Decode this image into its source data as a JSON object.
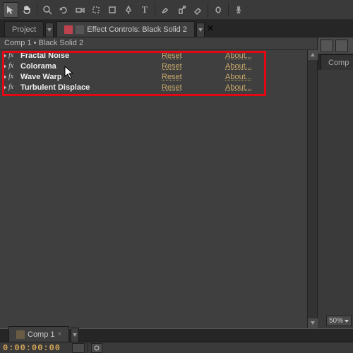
{
  "toolbar": {
    "tools": [
      "selection",
      "hand",
      "zoom",
      "rotate",
      "camera",
      "pan-behind",
      "mask-rect",
      "pen",
      "text",
      "brush",
      "clone",
      "eraser",
      "roto",
      "puppet"
    ]
  },
  "tabs": {
    "project": "Project",
    "effect_controls": "Effect Controls: Black Solid 2",
    "right_panel": "Comp"
  },
  "panel": {
    "breadcrumb": "Comp 1 • Black Solid 2"
  },
  "effects": [
    {
      "name": "Fractal Noise",
      "reset": "Reset",
      "about": "About..."
    },
    {
      "name": "Colorama",
      "reset": "Reset",
      "about": "About..."
    },
    {
      "name": "Wave Warp",
      "reset": "Reset",
      "about": "About..."
    },
    {
      "name": "Turbulent Displace",
      "reset": "Reset",
      "about": "About..."
    }
  ],
  "bottom": {
    "comp_tab": "Comp 1",
    "timecode": "0:00:00:00"
  },
  "zoom": "50%"
}
